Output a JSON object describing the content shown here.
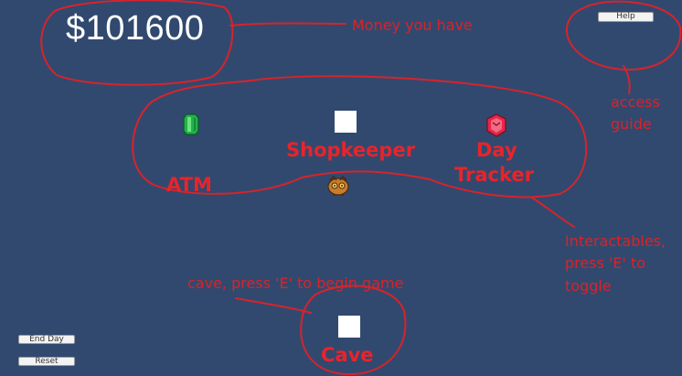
{
  "hud": {
    "money": "$101600",
    "help_label": "Help",
    "end_day_label": "End Day",
    "reset_label": "Reset"
  },
  "world": {
    "atm_label": "ATM",
    "shopkeeper_label": "Shopkeeper",
    "day_tracker_label_line1": "Day",
    "day_tracker_label_line2": "Tracker",
    "cave_label": "Cave"
  },
  "annotations": {
    "money_note": "Money you have",
    "guide_note_line1": "access",
    "guide_note_line2": "guide",
    "cave_note": "cave, press 'E' to begin game",
    "interact_note_line1": "Interactables,",
    "interact_note_line2": "press 'E' to",
    "interact_note_line3": "toggle"
  },
  "colors": {
    "background": "#31496f",
    "annotation": "#d8232a",
    "label": "#e8242a"
  }
}
